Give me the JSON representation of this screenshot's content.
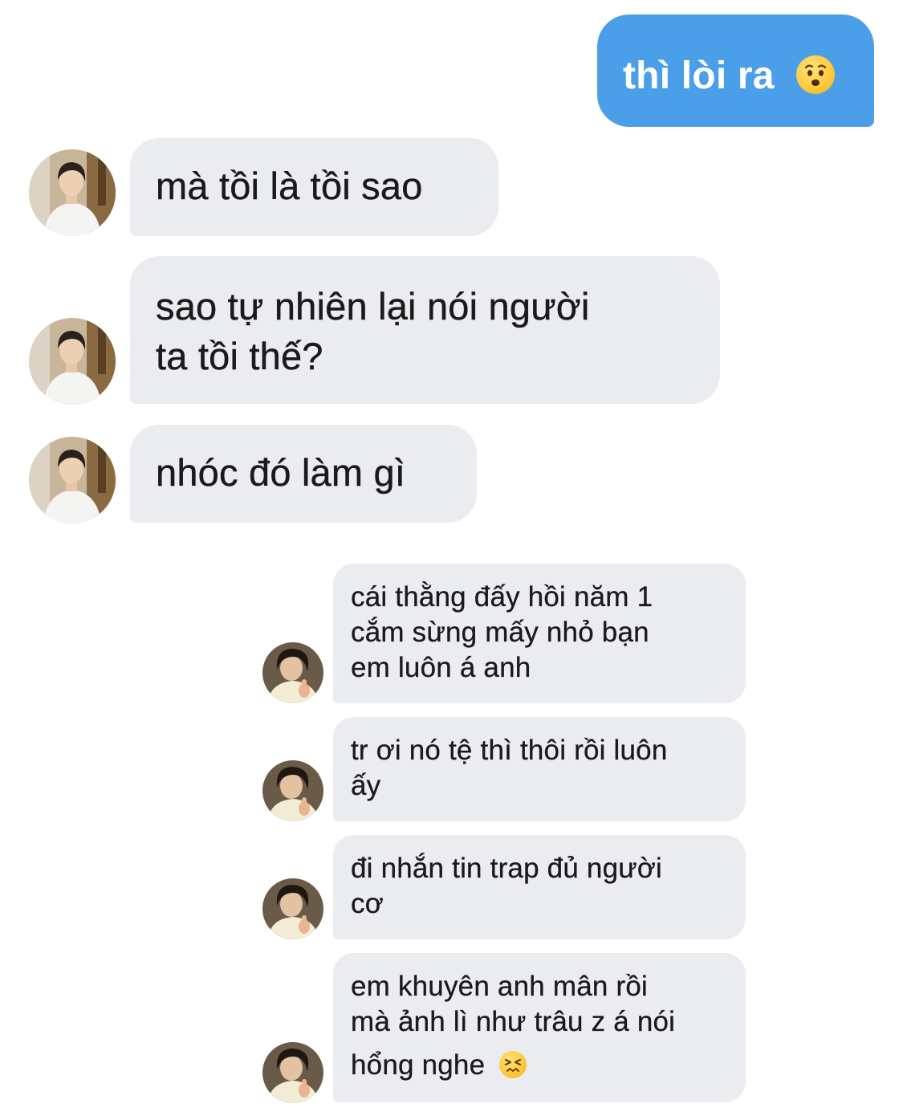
{
  "messages": [
    {
      "direction": "outgoing",
      "text": "thì lòi ra",
      "emoji": "worried-face-icon"
    },
    {
      "direction": "incoming",
      "sender": "contact-a",
      "text": "mà tồi là tồi sao"
    },
    {
      "direction": "incoming",
      "sender": "contact-a",
      "lines": [
        "sao tự nhiên lại nói người",
        "ta tồi thế?"
      ]
    },
    {
      "direction": "incoming",
      "sender": "contact-a",
      "text": "nhóc đó làm gì"
    },
    {
      "direction": "incoming",
      "sender": "contact-b",
      "lines": [
        "cái thằng đấy hồi năm 1",
        "cắm sừng mấy nhỏ bạn",
        "em luôn á anh"
      ]
    },
    {
      "direction": "incoming",
      "sender": "contact-b",
      "lines": [
        "tr ơi nó tệ thì thôi rồi luôn",
        "ấy"
      ]
    },
    {
      "direction": "incoming",
      "sender": "contact-b",
      "lines": [
        "đi nhắn tin trap đủ người",
        "cơ"
      ]
    },
    {
      "direction": "incoming",
      "sender": "contact-b",
      "lines": [
        "em khuyên anh mân rồi",
        "mà ảnh lì như trâu z á nói",
        "hổng nghe"
      ],
      "emoji": "confounded-face-icon"
    }
  ],
  "colors": {
    "outgoing_bubble": "#4b9fe9",
    "incoming_bubble": "#eaecf0",
    "background": "#ffffff"
  }
}
